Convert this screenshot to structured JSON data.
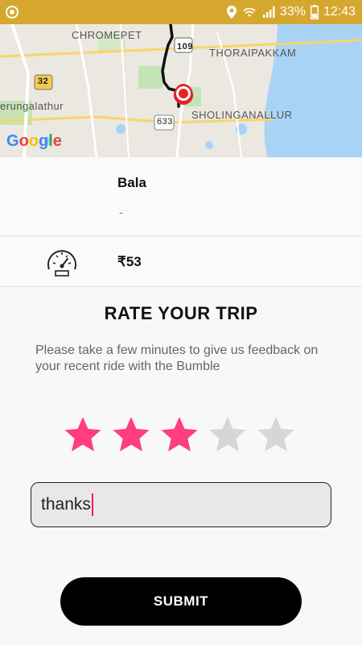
{
  "status_bar": {
    "battery_percent": "33%",
    "time": "12:43",
    "background_color": "#d6a72e"
  },
  "map": {
    "labels": {
      "chromepet": "CHROMEPET",
      "thoraipakkam": "THORAIPAKKAM",
      "perungalathur": "erungalathur",
      "sholinganallur": "SHOLINGANALLUR",
      "road_109": "109",
      "road_32": "32",
      "road_633": "633"
    },
    "attribution": "Google"
  },
  "driver": {
    "name": "Bala",
    "sub": "-"
  },
  "fare": {
    "amount": "₹53",
    "icon": "speedometer-icon"
  },
  "rating": {
    "title": "RATE YOUR TRIP",
    "description": "Please take a few minutes to give us feedback on your recent ride with the Bumble",
    "stars_total": 5,
    "stars_selected": 3,
    "active_color": "#ff3d7f",
    "inactive_color": "#d6d6d6"
  },
  "feedback": {
    "value": "thanks"
  },
  "submit": {
    "label": "SUBMIT"
  }
}
